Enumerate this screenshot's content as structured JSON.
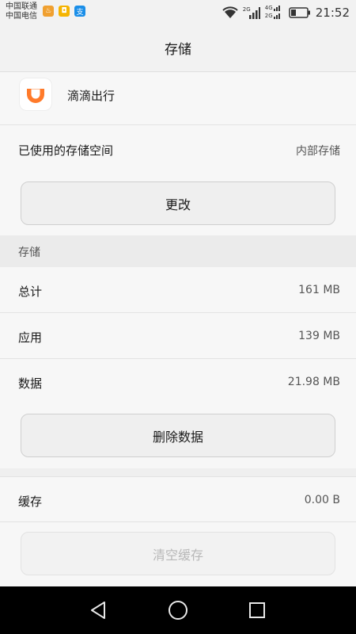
{
  "status_bar": {
    "carrier_1": "中国联通",
    "carrier_2": "中国电信",
    "net_1": "2G",
    "net_2_top": "4G",
    "net_2_bottom": "2G",
    "time": "21:52"
  },
  "header": {
    "title": "存储"
  },
  "app": {
    "name": "滴滴出行",
    "logo_color": "#ff7a2a"
  },
  "storage_location": {
    "label": "已使用的存储空间",
    "value": "内部存储"
  },
  "change_button": {
    "label": "更改"
  },
  "storage_section": {
    "title": "存储",
    "rows": [
      {
        "label": "总计",
        "value": "161 MB"
      },
      {
        "label": "应用",
        "value": "139 MB"
      },
      {
        "label": "数据",
        "value": "21.98 MB"
      }
    ]
  },
  "delete_data_button": {
    "label": "删除数据"
  },
  "cache": {
    "label": "缓存",
    "value": "0.00 B"
  },
  "clear_cache_button": {
    "label": "清空缓存"
  },
  "navigation": {
    "back": "back-icon",
    "home": "home-icon",
    "recents": "recents-icon"
  }
}
